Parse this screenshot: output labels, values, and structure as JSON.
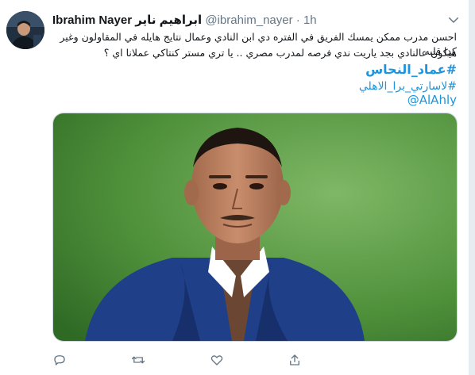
{
  "tweet": {
    "author_name": "Ibrahim Nayer",
    "author_name_ar": "ابراهيم ناير",
    "handle": "@ibrahim_nayer",
    "separator": "·",
    "time": "1h",
    "text_line1": "احسن مدرب ممكن يمسك الفريق في الفتره دي ابن النادي وعمال نتايج هايله في المقاولون وغير كدا قلبه",
    "text_line2": "هيكون عالنادي بجد ياريت ندي فرصه لمدرب مصري .. يا تري مستر كنتاكي عملانا اي ؟",
    "hashtag1": "#عماد_النحاس",
    "hashtag2": "#لاسارتي_برا_الاهلي",
    "mention": "@AlAhly"
  },
  "icons": {
    "caret": "chevron-down-icon",
    "reply": "reply-icon",
    "retweet": "retweet-icon",
    "like": "heart-icon",
    "share": "share-icon"
  },
  "colors": {
    "link": "#1b95e0",
    "secondary": "#657786",
    "pitch_green": "#4e8f3a"
  }
}
